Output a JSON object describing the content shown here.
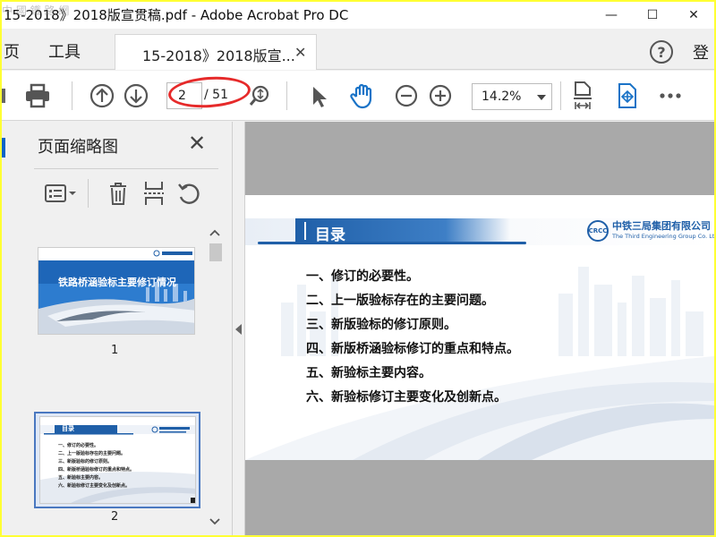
{
  "window": {
    "title": "15-2018》2018版宣贯稿.pdf - Adobe Acrobat Pro DC",
    "watermark": "中 國 鐵 路 網",
    "minimize": "—",
    "maximize": "☐",
    "close": "✕"
  },
  "menu": {
    "home": "页",
    "tools": "工具",
    "tab_label": "15-2018》2018版宣...",
    "tab_close": "✕",
    "help": "?",
    "login": "登"
  },
  "toolbar": {
    "current_page": "2",
    "total_pages": "/ 51",
    "zoom": "14.2%"
  },
  "panel": {
    "title": "页面缩略图",
    "close": "✕",
    "thumbnails": [
      {
        "number": "1",
        "title": "铁路桥涵验标主要修订情况"
      },
      {
        "number": "2",
        "title": "目录"
      }
    ]
  },
  "page": {
    "header_title": "目录",
    "logo_mark": "CRCC",
    "logo_cn": "中铁三局集团有限公司",
    "logo_en": "The Third Engineering Group Co. Ltd.",
    "toc": [
      "一、修订的必要性。",
      "二、上一版验标存在的主要问题。",
      "三、新版验标的修订原则。",
      "四、新版桥涵验标修订的重点和特点。",
      "五、新验标主要内容。",
      "六、新验标修订主要变化及创新点。"
    ]
  },
  "colors": {
    "accent_blue": "#1f5fa8",
    "annotation_red": "#e62a2a",
    "frame_yellow": "#ffff33"
  }
}
